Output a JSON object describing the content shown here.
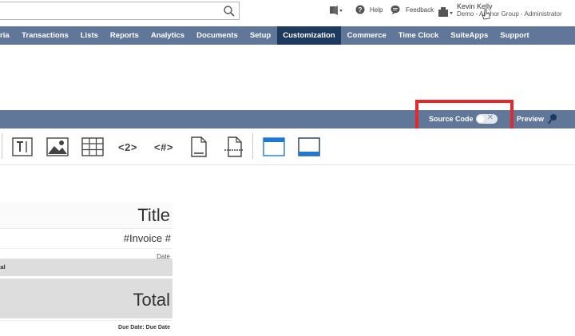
{
  "header": {
    "search_value": "",
    "help_label": "Help",
    "feedback_label": "Feedback",
    "user": {
      "name": "Kevin Kelly",
      "role": "Demo - Anchor Group - Administrator"
    }
  },
  "nav": {
    "items": [
      {
        "label": "ria"
      },
      {
        "label": "Transactions"
      },
      {
        "label": "Lists"
      },
      {
        "label": "Reports"
      },
      {
        "label": "Analytics"
      },
      {
        "label": "Documents"
      },
      {
        "label": "Setup"
      },
      {
        "label": "Customization",
        "active": true
      },
      {
        "label": "Commerce"
      },
      {
        "label": "Time Clock"
      },
      {
        "label": "SuiteApps"
      },
      {
        "label": "Support"
      }
    ]
  },
  "editor_bar": {
    "source_code_label": "Source Code",
    "source_code_on": false,
    "toggle_off_glyph": "✕",
    "preview_label": "Preview"
  },
  "toolbar": {
    "icons": [
      "text-box-icon",
      "image-icon",
      "table-icon",
      "page-number-icon",
      "total-pages-icon",
      "page-break-icon",
      "insert-page-break-icon",
      "header-layout-icon",
      "footer-layout-icon"
    ],
    "page_number_text": "<2>",
    "total_pages_text": "<#>"
  },
  "template": {
    "title": "Title",
    "invoice_number": "#Invoice #",
    "date_label": "Date",
    "total_header_partial": "tal",
    "total_label": "Total",
    "due_date": "Due Date: Due Date"
  },
  "colors": {
    "nav_bg": "#607799",
    "nav_active_bg": "#1f3a5f",
    "highlight": "#e8272a",
    "layout_icon_blue": "#1f78d1",
    "template_gray": "#dddddd"
  }
}
